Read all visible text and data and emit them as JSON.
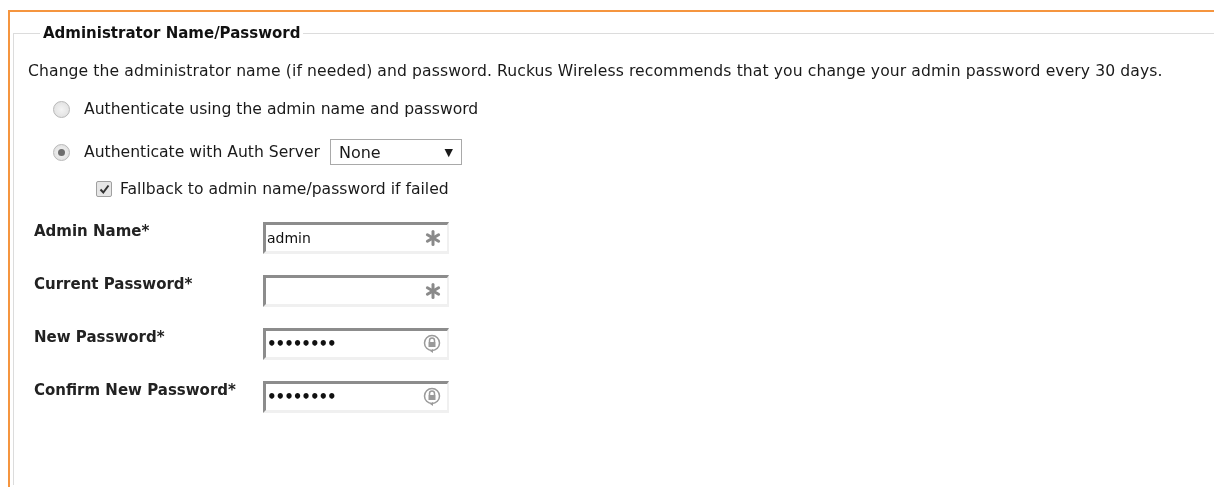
{
  "section": {
    "title": "Administrator Name/Password",
    "description": "Change the administrator name (if needed) and password. Ruckus Wireless recommends that you change your admin password every 30 days."
  },
  "auth_options": [
    {
      "label": "Authenticate using the admin name and password",
      "selected": false
    },
    {
      "label": "Authenticate with Auth Server",
      "selected": true,
      "dropdown": {
        "value": "None",
        "caret": "▼"
      }
    }
  ],
  "fallback": {
    "label": "Fallback to admin name/password if failed",
    "checked": true
  },
  "fields": [
    {
      "label": "Admin Name*",
      "value": "admin",
      "kind": "required"
    },
    {
      "label": "Current Password*",
      "kind": "required"
    },
    {
      "label": "New Password*",
      "value": "••••••••",
      "kind": "password"
    },
    {
      "label": "Confirm New Password*",
      "value": "••••••••",
      "kind": "password"
    }
  ]
}
